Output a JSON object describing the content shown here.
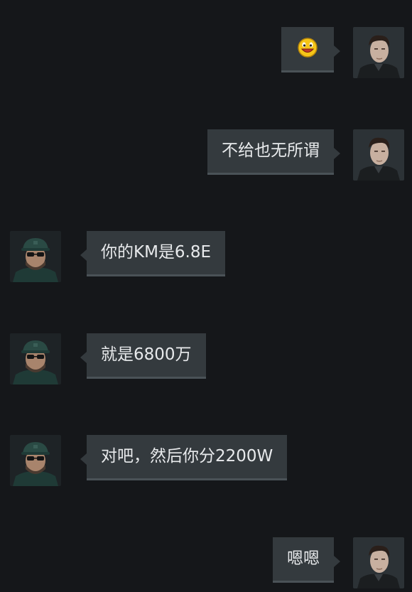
{
  "messages": [
    {
      "side": "right",
      "sender": "self",
      "type": "emoji",
      "icon": "smiley-face-icon"
    },
    {
      "side": "right",
      "sender": "self",
      "type": "text",
      "text": "不给也无所谓"
    },
    {
      "side": "left",
      "sender": "other",
      "type": "text",
      "text": "你的KM是6.8E"
    },
    {
      "side": "left",
      "sender": "other",
      "type": "text",
      "text": "就是6800万"
    },
    {
      "side": "left",
      "sender": "other",
      "type": "text",
      "text": "对吧，然后你分2200W"
    },
    {
      "side": "right",
      "sender": "self",
      "type": "text",
      "text": "嗯嗯"
    }
  ],
  "colors": {
    "background": "#15171a",
    "bubble": "#343a3e",
    "bubble_border": "#4a5257",
    "text": "#e8eaec"
  }
}
